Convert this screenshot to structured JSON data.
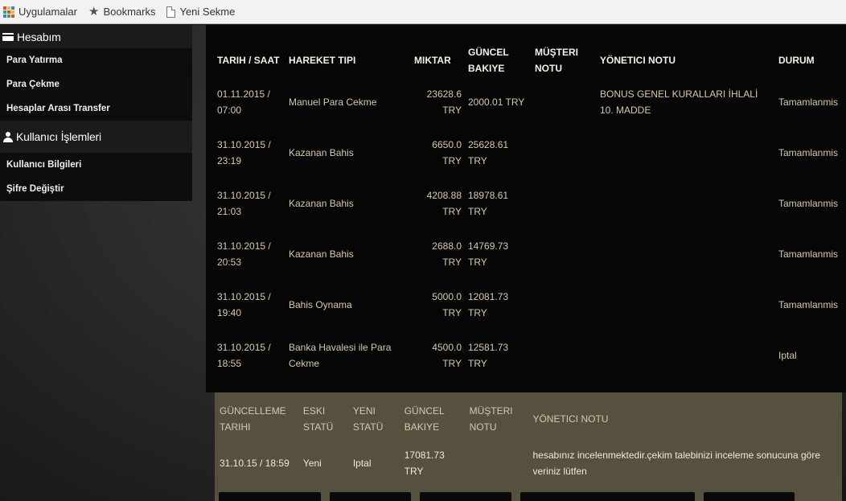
{
  "bookmarks_bar": {
    "items": [
      {
        "label": "Uygulamalar",
        "icon": "apps-grid-icon"
      },
      {
        "label": "Bookmarks",
        "icon": "star-icon"
      },
      {
        "label": "Yeni Sekme",
        "icon": "page-icon"
      }
    ],
    "apps_colors": [
      "#e8453c",
      "#f9bb2d",
      "#3a7de1",
      "#34a853",
      "#e8453c",
      "#f9bb2d",
      "#3a7de1",
      "#34a853",
      "#e8453c"
    ]
  },
  "sidebar": {
    "sections": [
      {
        "title": "Hesabım",
        "icon": "card-icon",
        "items": [
          "Para Yatırma",
          "Para Çekme",
          "Hesaplar Arası Transfer"
        ]
      },
      {
        "title": "Kullanıcı İşlemleri",
        "icon": "user-icon",
        "items": [
          "Kullanıcı Bilgileri",
          "Şifre Değiştir"
        ]
      }
    ]
  },
  "transactions": {
    "headers": {
      "date": "TARIH / SAAT",
      "type": "HAREKET TIPI",
      "amount": "MIKTAR",
      "balance": "GÜNCEL BAKIYE",
      "customer_note": "MÜŞTERI NOTU",
      "admin_note": "YÖNETICI NOTU",
      "status": "DURUM"
    },
    "rows": [
      {
        "date": "01.11.2015 / 07:00",
        "type": "Manuel Para Cekme",
        "amount": "23628.6 TRY",
        "balance": "2000.01 TRY",
        "customer_note": "",
        "admin_note": "BONUS GENEL KURALLARI İHLALİ 10. MADDE",
        "status": "Tamamlanmis"
      },
      {
        "date": "31.10.2015 / 23:19",
        "type": "Kazanan Bahis",
        "amount": "6650.0 TRY",
        "balance": "25628.61 TRY",
        "customer_note": "",
        "admin_note": "",
        "status": "Tamamlanmis"
      },
      {
        "date": "31.10.2015 / 21:03",
        "type": "Kazanan Bahis",
        "amount": "4208.88 TRY",
        "balance": "18978.61 TRY",
        "customer_note": "",
        "admin_note": "",
        "status": "Tamamlanmis"
      },
      {
        "date": "31.10.2015 / 20:53",
        "type": "Kazanan Bahis",
        "amount": "2688.0 TRY",
        "balance": "14769.73 TRY",
        "customer_note": "",
        "admin_note": "",
        "status": "Tamamlanmis"
      },
      {
        "date": "31.10.2015 / 19:40",
        "type": "Bahis Oynama",
        "amount": "5000.0 TRY",
        "balance": "12081.73 TRY",
        "customer_note": "",
        "admin_note": "",
        "status": "Tamamlanmis"
      },
      {
        "date": "31.10.2015 / 18:55",
        "type": "Banka Havalesi ile Para Cekme",
        "amount": "4500.0 TRY",
        "balance": "12581.73 TRY",
        "customer_note": "",
        "admin_note": "",
        "status": "Iptal"
      }
    ]
  },
  "update_panel": {
    "headers": {
      "date": "GÜNCELLEME TARIHI",
      "old_status": "ESKI STATÜ",
      "new_status": "YENI STATÜ",
      "balance": "GÜNCEL BAKIYE",
      "customer_note": "MÜŞTERI NOTU",
      "admin_note": "YÖNETICI NOTU"
    },
    "row": {
      "date": "31.10.15 / 18:59",
      "old_status": "Yeni",
      "new_status": "Iptal",
      "balance": "17081.73 TRY",
      "customer_note": "",
      "admin_note": "hesabınız incelenmektedir.çekim talebinizi inceleme sonucuna göre veriniz lütfen"
    }
  }
}
